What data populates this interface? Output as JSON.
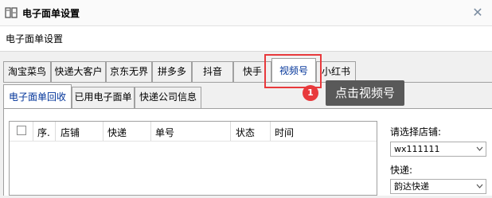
{
  "window": {
    "title": "电子面单设置",
    "close_glyph": "✕"
  },
  "heading": "电子面单设置",
  "tabs": [
    {
      "label": "淘宝菜鸟",
      "active": false
    },
    {
      "label": "快递大客户",
      "active": false
    },
    {
      "label": "京东无界",
      "active": false
    },
    {
      "label": "拼多多",
      "active": false
    },
    {
      "label": "抖音",
      "active": false
    },
    {
      "label": "快手",
      "active": false
    },
    {
      "label": "视频号",
      "active": true
    },
    {
      "label": "小红书",
      "active": false
    }
  ],
  "subtabs": [
    {
      "label": "电子面单回收",
      "active": true
    },
    {
      "label": "已用电子面单",
      "active": false
    },
    {
      "label": "快递公司信息",
      "active": false
    }
  ],
  "grid": {
    "columns": [
      "序.",
      "店铺",
      "快递",
      "单号",
      "状态",
      "时间"
    ]
  },
  "side": {
    "shop_label": "请选择店铺:",
    "shop_value": "wx111111",
    "express_label": "快递:",
    "express_value": "韵达快递"
  },
  "annotation": {
    "step": "1",
    "text": "点击视频号",
    "color": "#e8393c"
  },
  "icons": {
    "app": "settings-app-icon",
    "close": "close-icon",
    "dropdown": "chevron-down-icon"
  }
}
